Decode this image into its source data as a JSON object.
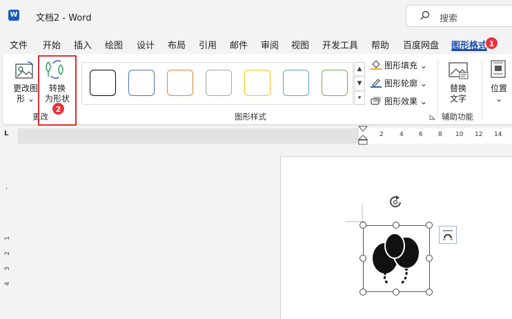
{
  "titlebar": {
    "app_icon": "word-icon",
    "app_icon_letter": "W",
    "document_title": "文档2  -  Word",
    "search_placeholder": "搜索",
    "search_icon": "search-icon"
  },
  "tabs": [
    {
      "label": "文件"
    },
    {
      "label": "开始"
    },
    {
      "label": "插入"
    },
    {
      "label": "绘图"
    },
    {
      "label": "设计"
    },
    {
      "label": "布局"
    },
    {
      "label": "引用"
    },
    {
      "label": "邮件"
    },
    {
      "label": "审阅"
    },
    {
      "label": "视图"
    },
    {
      "label": "开发工具"
    },
    {
      "label": "帮助"
    },
    {
      "label": "百度网盘"
    },
    {
      "label": "图形格式",
      "active": true
    }
  ],
  "annotations": {
    "badge_1": "1",
    "badge_2": "2"
  },
  "ribbon": {
    "change_group": {
      "change_shape_label_line1": "更改图",
      "change_shape_label_line2": "形 ⌄",
      "convert_label_line1": "转换",
      "convert_label_line2": "为形状",
      "group_label": "更改"
    },
    "styles_group": {
      "swatch_colors": [
        "#000000",
        "#4472c4",
        "#ed7d31",
        "#a5a5a5",
        "#ffc000",
        "#5b9bd5",
        "#70ad47"
      ],
      "fill_label": "图形填充 ⌄",
      "outline_label": "图形轮廓 ⌄",
      "effects_label": "图形效果 ⌄",
      "group_label": "图形样式",
      "fill_color": "#f5a623",
      "outline_color": "#2e5fb8"
    },
    "accessibility_group": {
      "alt_text_label_line1": "替换",
      "alt_text_label_line2": "文字",
      "group_label": "辅助功能"
    },
    "position_group": {
      "position_label": "位置",
      "position_chevron": "⌄"
    }
  },
  "ruler": {
    "corner": "L",
    "h_ticks": [
      "2",
      "4",
      "6",
      "8",
      "10",
      "12",
      "14"
    ],
    "v_ticks": [
      "1",
      "2",
      "3",
      "4"
    ]
  },
  "colors": {
    "accent": "#1d4fb0",
    "highlight_red": "#e02d2d"
  }
}
